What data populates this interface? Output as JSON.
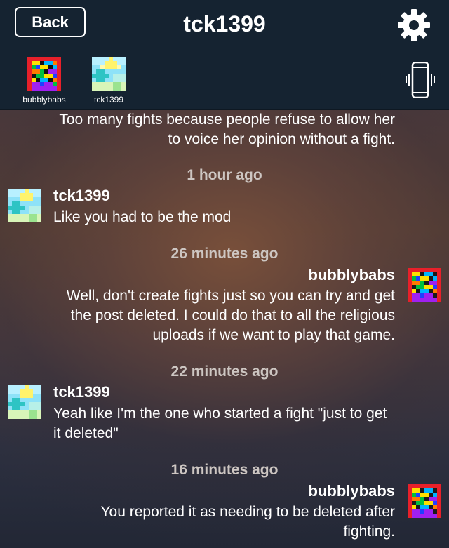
{
  "header": {
    "back_label": "Back",
    "title": "tck1399",
    "settings_icon": "gear-icon",
    "vibrate_icon": "phone-vibrate-icon"
  },
  "participants": [
    {
      "label": "bubblybabs",
      "avatar": "rainbow-pixel-avatar"
    },
    {
      "label": "tck1399",
      "avatar": "sky-pixel-avatar"
    }
  ],
  "messages": [
    {
      "text_lines": [
        "Too many fights because people refuse to allow her",
        "to voice her opinion without a fight."
      ]
    },
    {
      "timestamp": "1 hour ago",
      "sender": "tck1399",
      "text_lines": [
        "Like you had to be the mod"
      ]
    },
    {
      "timestamp": "26 minutes ago",
      "sender": "bubblybabs",
      "text_lines": [
        "Well, don't create fights just so you can try and get",
        "the post deleted.  I could do that to all the religious",
        "uploads if we want to play that game."
      ]
    },
    {
      "timestamp": "22 minutes ago",
      "sender": "tck1399",
      "text_lines": [
        "Yeah like I'm the one who started a fight \"just to get",
        "it deleted\""
      ]
    },
    {
      "timestamp": "16 minutes ago",
      "sender": "bubblybabs",
      "text_lines": [
        "You reported it as needing to be deleted after",
        "fighting."
      ]
    }
  ],
  "colors": {
    "header_bg": "#152331",
    "text": "#ffffff",
    "timestamp": "#cdc6c2"
  }
}
